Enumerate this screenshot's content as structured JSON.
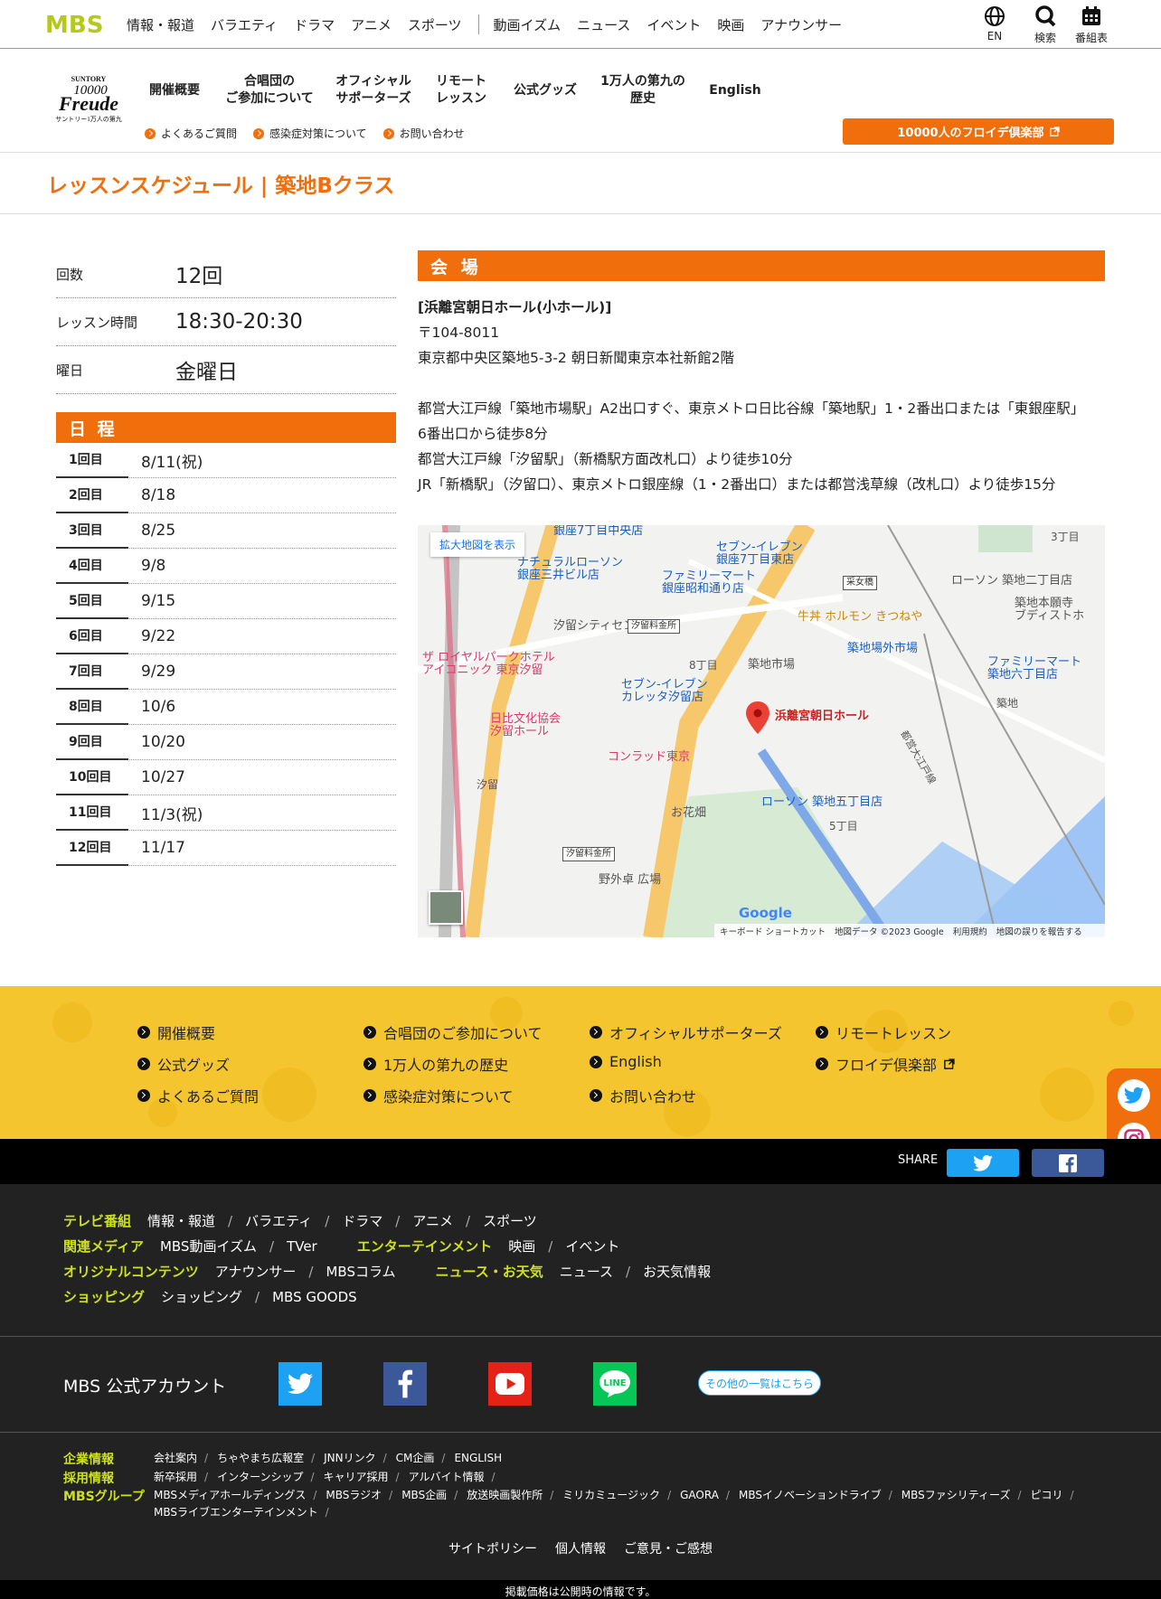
{
  "topbar": {
    "logo": "MBS",
    "nav": [
      "情報・報道",
      "バラエティ",
      "ドラマ",
      "アニメ",
      "スポーツ",
      "動画イズム",
      "ニュース",
      "イベント",
      "映画",
      "アナウンサー"
    ],
    "icons": [
      {
        "icon": "globe-icon",
        "label": "EN"
      },
      {
        "icon": "search-icon",
        "label": "検索"
      },
      {
        "icon": "calendar-icon",
        "label": "番組表"
      }
    ]
  },
  "site": {
    "logo_brand": "SUNTORY",
    "logo_number": "10000",
    "logo_script": "Freude",
    "logo_sub": "サントリー1万人の第九",
    "nav": [
      "開催概要",
      "合唱団の\nご参加について",
      "オフィシャル\nサポーターズ",
      "リモート\nレッスン",
      "公式グッズ",
      "1万人の第九の\n歴史",
      "English"
    ],
    "subnav": [
      "よくあるご質問",
      "感染症対策について",
      "お問い合わせ"
    ],
    "club_button": "10000人のフロイデ倶楽部"
  },
  "page_title": "レッスンスケジュール | 築地Bクラス",
  "info": [
    {
      "label": "回数",
      "value": "12回"
    },
    {
      "label": "レッスン時間",
      "value": "18:30-20:30"
    },
    {
      "label": "曜日",
      "value": "金曜日"
    }
  ],
  "schedule": {
    "heading": "日 程",
    "rows": [
      {
        "n": "1回目",
        "d": "8/11(祝)"
      },
      {
        "n": "2回目",
        "d": "8/18"
      },
      {
        "n": "3回目",
        "d": "8/25"
      },
      {
        "n": "4回目",
        "d": "9/8"
      },
      {
        "n": "5回目",
        "d": "9/15"
      },
      {
        "n": "6回目",
        "d": "9/22"
      },
      {
        "n": "7回目",
        "d": "9/29"
      },
      {
        "n": "8回目",
        "d": "10/6"
      },
      {
        "n": "9回目",
        "d": "10/20"
      },
      {
        "n": "10回目",
        "d": "10/27"
      },
      {
        "n": "11回目",
        "d": "11/3(祝)"
      },
      {
        "n": "12回目",
        "d": "11/17"
      }
    ]
  },
  "venue": {
    "heading": "会 場",
    "name": "[浜離宮朝日ホール(小ホール)]",
    "zip": "〒104-8011",
    "address": "東京都中央区築地5-3-2 朝日新聞東京本社新館2階",
    "access1a": "都営大江戸線「築地市場駅」A2出口すぐ、東京メトロ日比谷線「築地駅」1・2番出口または「東銀座駅」",
    "access1b": "6番出口から徒歩8分",
    "access2": "都営大江戸線「汐留駅」（新橋駅方面改札口）より徒歩10分",
    "access3": "JR「新橋駅」（汐留口）、東京メトロ銀座線（1・2番出口）または都営浅草線（改札口）より徒歩15分"
  },
  "map": {
    "enlarge": "拡大地図を表示",
    "marker_label": "浜離宮朝日ホール",
    "labels": [
      "銀座7丁目中央店",
      "セブン-イレブン\n銀座7丁目東店",
      "ナチュラルローソン\n銀座三井ビル店",
      "ファミリーマート\n銀座昭和通り店",
      "汐留シティセンター",
      "牛丼 ホルモン きつねや",
      "ローソン 築地二丁目店",
      "築地本願寺\nブディストホ",
      "築地場外市場",
      "築地市場",
      "ファミリーマート\n築地六丁目店",
      "ザ ロイヤルパークホテル\nアイコニック 東京汐留",
      "セブン-イレブン\nカレッタ汐留店",
      "日比文化協会\n汐留ホール",
      "コンラッド東京",
      "ローソン 築地五丁目店",
      "お花畑",
      "野外卓 広場",
      "築地",
      "8丁目",
      "5丁目",
      "3丁目",
      "汐留",
      "汐留料金所",
      "汐留料金所",
      "采女橋",
      "都営大江戸線"
    ],
    "footer": [
      "キーボード ショートカット",
      "地図データ ©2023 Google",
      "利用規約",
      "地図の誤りを報告する"
    ],
    "google": "Google"
  },
  "footer_nav": [
    [
      "開催概要",
      "合唱団のご参加について",
      "オフィシャルサポーターズ",
      "リモートレッスン"
    ],
    [
      "公式グッズ",
      "1万人の第九の歴史",
      "English",
      "フロイデ倶楽部"
    ],
    [
      "よくあるご質問",
      "感染症対策について",
      "お問い合わせ"
    ]
  ],
  "share_label": "SHARE",
  "footer_links": {
    "tv_cat": "テレビ番組",
    "tv": [
      "情報・報道",
      "バラエティ",
      "ドラマ",
      "アニメ",
      "スポーツ"
    ],
    "media_cat": "関連メディア",
    "media": [
      "MBS動画イズム",
      "TVer"
    ],
    "ent_cat": "エンターテインメント",
    "ent": [
      "映画",
      "イベント"
    ],
    "orig_cat": "オリジナルコンテンツ",
    "orig": [
      "アナウンサー",
      "MBSコラム"
    ],
    "news_cat": "ニュース・お天気",
    "news": [
      "ニュース",
      "お天気情報"
    ],
    "shop_cat": "ショッピング",
    "shop": [
      "ショッピング",
      "MBS GOODS"
    ]
  },
  "accounts": {
    "label": "MBS 公式アカウント",
    "other": "その他の一覧はこちら"
  },
  "corp": {
    "info_cat": "企業情報",
    "info": [
      "会社案内",
      "ちゃやまち広報室",
      "JNNリンク",
      "CM企画",
      "ENGLISH"
    ],
    "recruit_cat": "採用情報",
    "recruit": [
      "新卒採用",
      "インターンシップ",
      "キャリア採用",
      "アルバイト情報"
    ],
    "group_cat": "MBSグループ",
    "group": [
      "MBSメディアホールディングス",
      "MBSラジオ",
      "MBS企画",
      "放送映画製作所",
      "ミリカミュージック",
      "GAORA",
      "MBSイノベーションドライブ",
      "MBSファシリティーズ",
      "ピコリ"
    ],
    "group2": [
      "MBSライブエンターテインメント"
    ]
  },
  "policy": [
    "サイトポリシー",
    "個人情報",
    "ご意見・ご感想"
  ],
  "bottom_note": "掲載価格は公開時の情報です。",
  "colors": {
    "accent": "#f06e0b",
    "footer_yellow": "#f5c530",
    "mbs_green": "#cde11d"
  }
}
